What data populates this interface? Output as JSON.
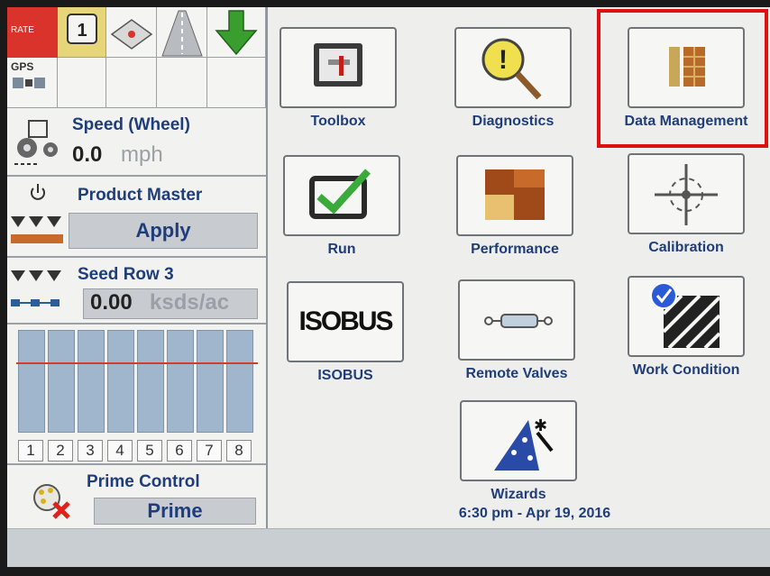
{
  "status": {
    "rate_label": "RATE",
    "gps_label": "GPS",
    "counter_value": "1"
  },
  "speed": {
    "title": "Speed (Wheel)",
    "value": "0.0",
    "unit": "mph"
  },
  "product_master": {
    "title": "Product Master",
    "button": "Apply"
  },
  "seed_row": {
    "title": "Seed Row 3",
    "value": "0.00",
    "unit": "ksds/ac"
  },
  "rows": [
    "1",
    "2",
    "3",
    "4",
    "5",
    "6",
    "7",
    "8"
  ],
  "prime_control": {
    "title": "Prime Control",
    "button": "Prime"
  },
  "apps": [
    {
      "label": "Toolbox",
      "icon": "toolbox-icon"
    },
    {
      "label": "Diagnostics",
      "icon": "magnifier-icon"
    },
    {
      "label": "Data Management",
      "icon": "data-management-icon"
    },
    {
      "label": "Run",
      "icon": "checkmark-icon"
    },
    {
      "label": "Performance",
      "icon": "performance-grid-icon"
    },
    {
      "label": "Calibration",
      "icon": "crosshair-icon"
    },
    {
      "label": "ISOBUS",
      "icon": "isobus-icon"
    },
    {
      "label": "Remote Valves",
      "icon": "cylinder-icon"
    },
    {
      "label": "Work Condition",
      "icon": "work-condition-icon"
    },
    {
      "label": "Wizards",
      "icon": "wizard-hat-icon"
    }
  ],
  "isobus_logo_text": "ISOBUS",
  "timestamp": "6:30 pm - Apr 19, 2016",
  "colors": {
    "accent": "#1e3d7a",
    "highlight": "#e01010",
    "target_line": "#d83a30"
  }
}
